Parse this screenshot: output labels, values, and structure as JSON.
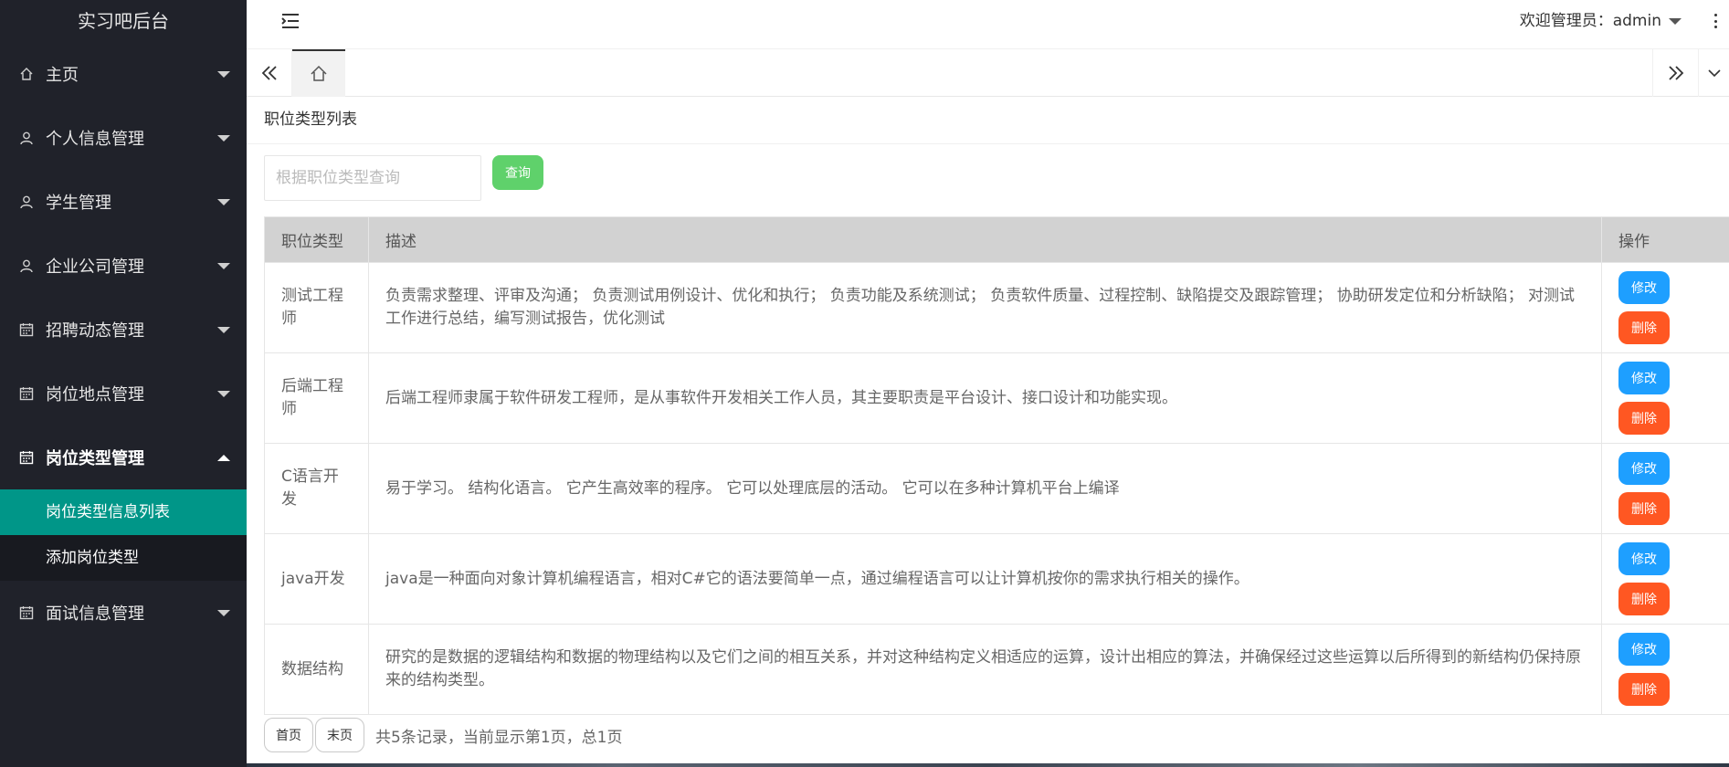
{
  "sidebar": {
    "logo": "实习吧后台",
    "items": [
      {
        "label": "主页",
        "icon": "home-icon"
      },
      {
        "label": "个人信息管理",
        "icon": "user-icon"
      },
      {
        "label": "学生管理",
        "icon": "user-icon"
      },
      {
        "label": "企业公司管理",
        "icon": "user-icon"
      },
      {
        "label": "招聘动态管理",
        "icon": "calendar-icon"
      },
      {
        "label": "岗位地点管理",
        "icon": "calendar-icon"
      },
      {
        "label": "岗位类型管理",
        "icon": "calendar-icon",
        "open": true
      },
      {
        "label": "面试信息管理",
        "icon": "calendar-icon"
      }
    ],
    "subitems": [
      {
        "label": "岗位类型信息列表",
        "active": true
      },
      {
        "label": "添加岗位类型"
      }
    ]
  },
  "header": {
    "welcome": "欢迎管理员：admin"
  },
  "page": {
    "title": "职位类型列表",
    "search": {
      "placeholder": "根据职位类型查询",
      "value": ""
    },
    "search_button": "查询"
  },
  "table": {
    "headers": [
      "职位类型",
      "描述",
      "操作"
    ],
    "rows": [
      {
        "type": "测试工程师",
        "desc": "负责需求整理、评审及沟通； 负责测试用例设计、优化和执行； 负责功能及系统测试； 负责软件质量、过程控制、缺陷提交及跟踪管理； 协助研发定位和分析缺陷； 对测试工作进行总结，编写测试报告，优化测试"
      },
      {
        "type": "后端工程师",
        "desc": "后端工程师隶属于软件研发工程师，是从事软件开发相关工作人员，其主要职责是平台设计、接口设计和功能实现。"
      },
      {
        "type": "C语言开发",
        "desc": "易于学习。 结构化语言。 它产生高效率的程序。 它可以处理底层的活动。 它可以在多种计算机平台上编译"
      },
      {
        "type": "java开发",
        "desc": "java是一种面向对象计算机编程语言，相对C#它的语法要简单一点，通过编程语言可以让计算机按你的需求执行相关的操作。"
      },
      {
        "type": "数据结构",
        "desc": "研究的是数据的逻辑结构和数据的物理结构以及它们之间的相互关系，并对这种结构定义相适应的运算，设计出相应的算法，并确保经过这些运算以后所得到的新结构仍保持原来的结构类型。"
      }
    ],
    "edit_label": "修改",
    "delete_label": "删除"
  },
  "pager": {
    "first": "首页",
    "last": "末页",
    "info": "共5条记录，当前显示第1页，总1页"
  }
}
